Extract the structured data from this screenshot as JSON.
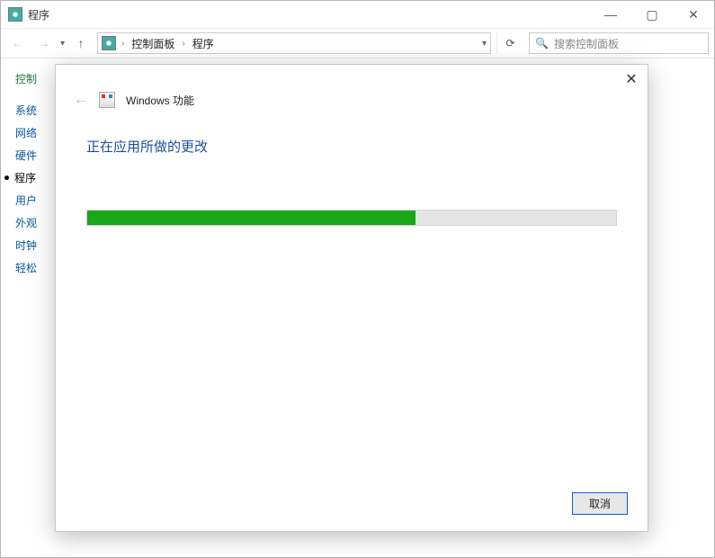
{
  "titlebar": {
    "title": "程序"
  },
  "toolbar": {
    "breadcrumb": {
      "root": "控制面板",
      "current": "程序"
    },
    "search_placeholder": "搜索控制面板"
  },
  "sidebar": {
    "home": "控制",
    "items": [
      {
        "label": "系统",
        "active": false
      },
      {
        "label": "网络",
        "active": false
      },
      {
        "label": "硬件",
        "active": false
      },
      {
        "label": "程序",
        "active": true
      },
      {
        "label": "用户",
        "active": false
      },
      {
        "label": "外观",
        "active": false
      },
      {
        "label": "时钟",
        "active": false
      },
      {
        "label": "轻松",
        "active": false
      }
    ]
  },
  "dialog": {
    "title": "Windows 功能",
    "heading": "正在应用所做的更改",
    "progress_percent": 62,
    "cancel_label": "取消"
  }
}
